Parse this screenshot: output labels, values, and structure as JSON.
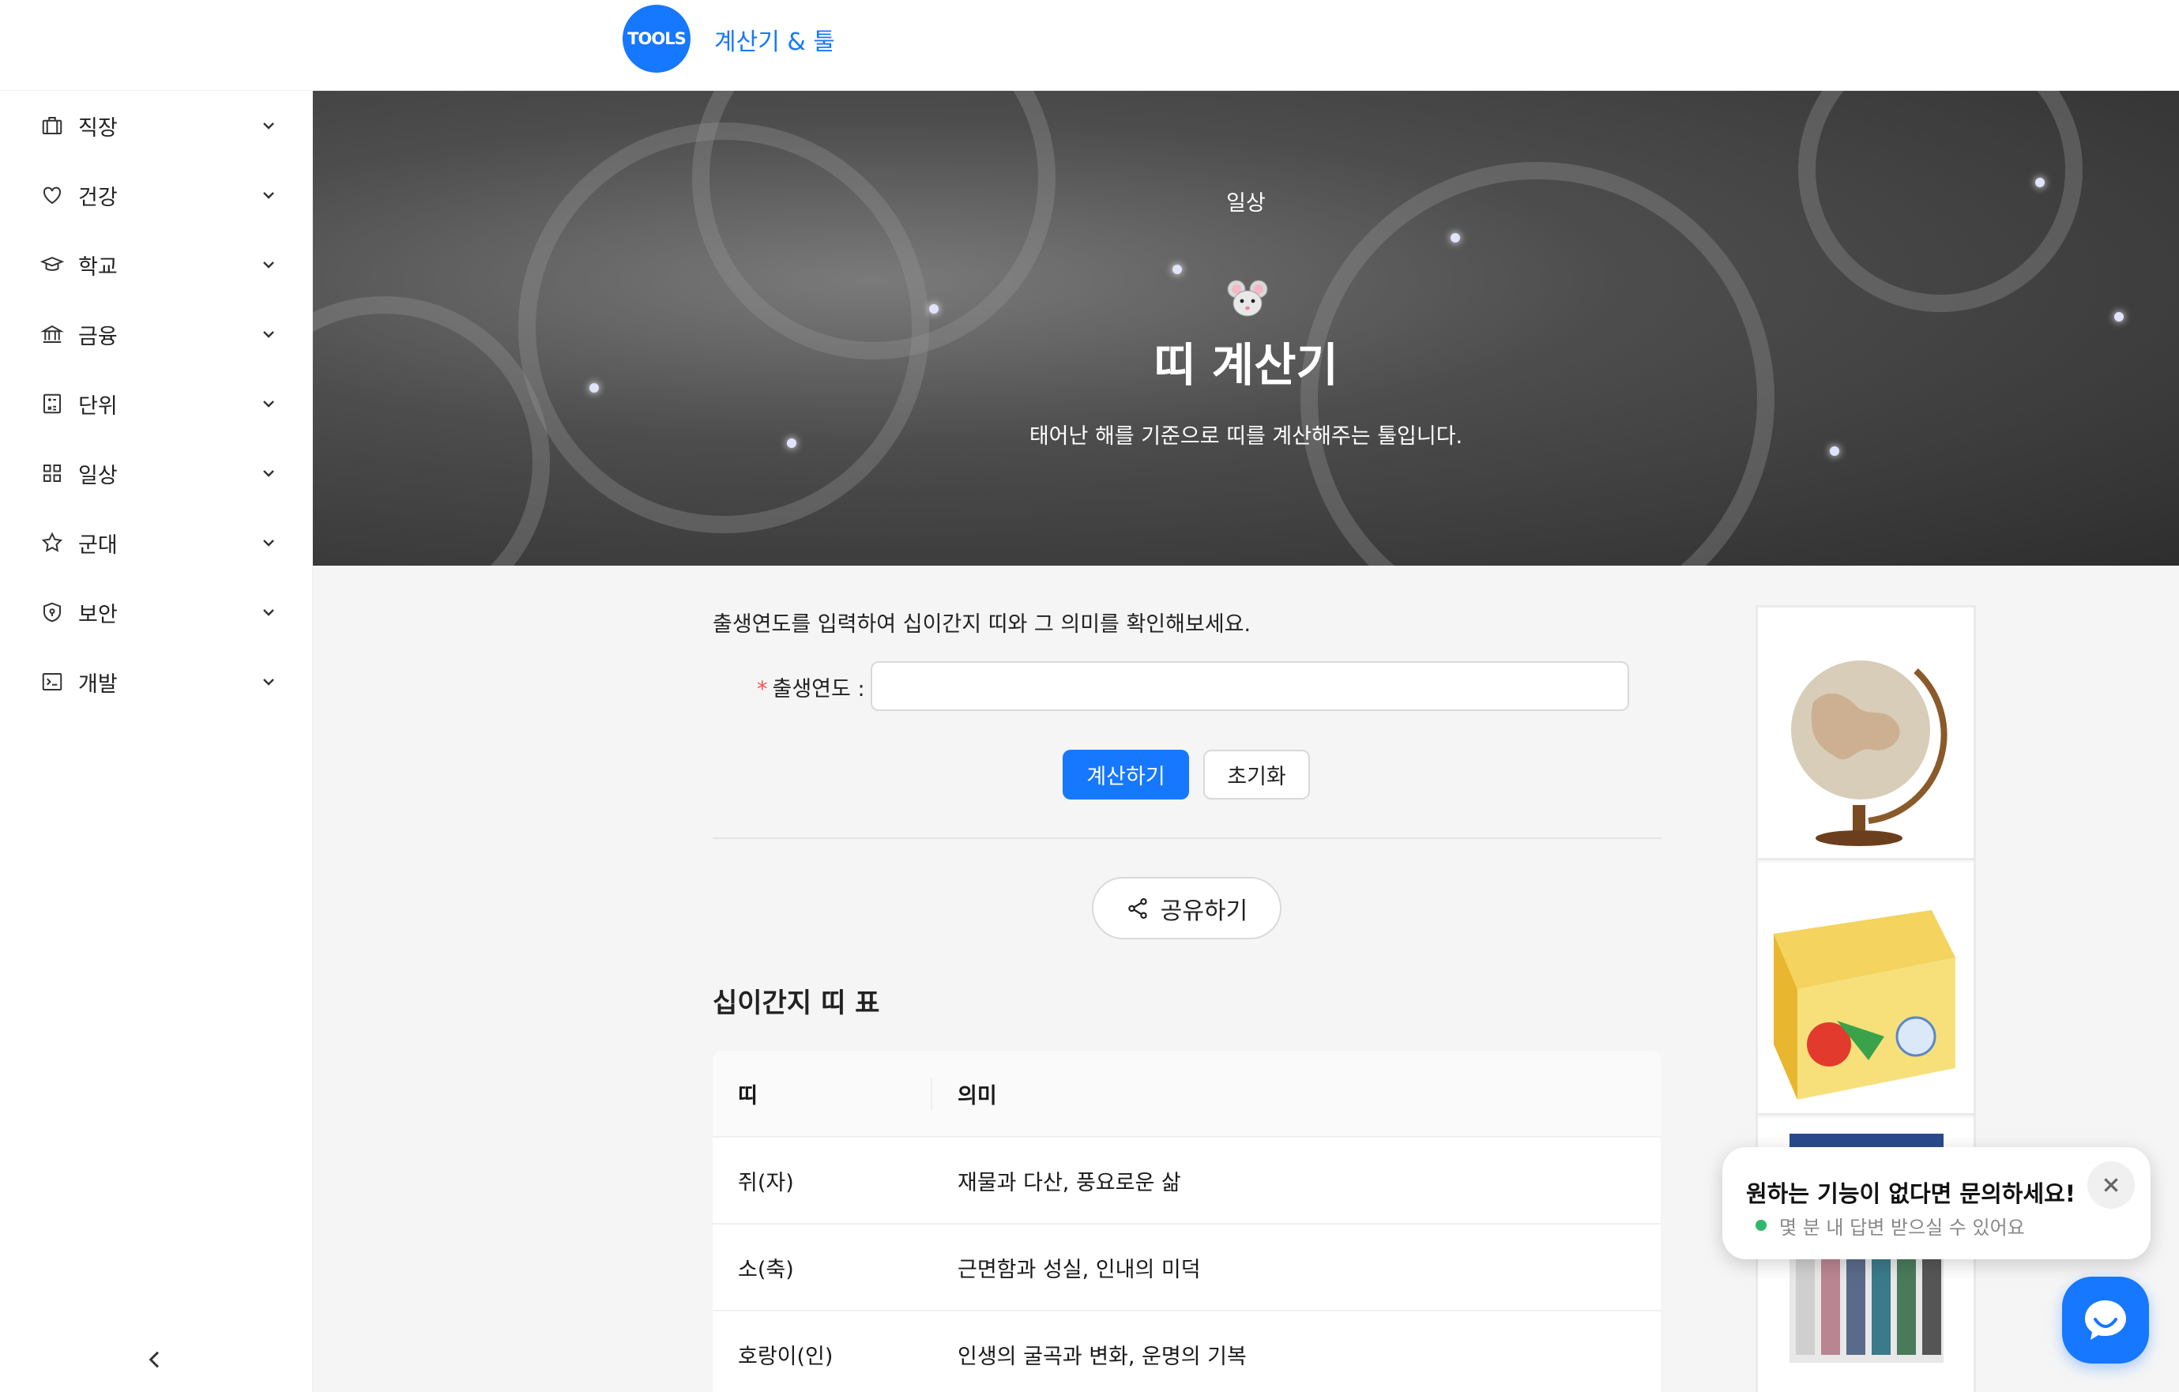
{
  "header": {
    "logo_text": "TOOLS",
    "site_title": "계산기 & 툴"
  },
  "sidebar": {
    "items": [
      {
        "label": "직장",
        "icon": "briefcase-icon"
      },
      {
        "label": "건강",
        "icon": "heart-icon"
      },
      {
        "label": "학교",
        "icon": "graduation-cap-icon"
      },
      {
        "label": "금융",
        "icon": "bank-icon"
      },
      {
        "label": "단위",
        "icon": "calculator-icon"
      },
      {
        "label": "일상",
        "icon": "grid-icon"
      },
      {
        "label": "군대",
        "icon": "star-icon"
      },
      {
        "label": "보안",
        "icon": "shield-icon"
      },
      {
        "label": "개발",
        "icon": "terminal-icon"
      }
    ]
  },
  "hero": {
    "category": "일상",
    "emoji": "mouse-face-icon",
    "title": "띠 계산기",
    "subtitle": "태어난 해를 기준으로 띠를 계산해주는 툴입니다."
  },
  "form": {
    "intro": "출생연도를 입력하여 십이간지 띠와 그 의미를 확인해보세요.",
    "required_mark": "*",
    "birth_year_label": "출생연도 :",
    "birth_year_value": "",
    "calculate_label": "계산하기",
    "reset_label": "초기화"
  },
  "share": {
    "label": "공유하기"
  },
  "table": {
    "title": "십이간지 띠 표",
    "headers": [
      "띠",
      "의미"
    ],
    "rows": [
      [
        "쥐(자)",
        "재물과 다산, 풍요로운 삶"
      ],
      [
        "소(축)",
        "근면함과 성실, 인내의 미덕"
      ],
      [
        "호랑이(인)",
        "인생의 굴곡과 변화, 운명의 기복"
      ]
    ]
  },
  "chat": {
    "title": "원하는 기능이 없다면 문의하세요!",
    "subtitle": "몇 분 내 답변 받으실 수 있어요"
  },
  "colors": {
    "accent": "#1677ff",
    "required": "#ff4d4f",
    "online": "#2fb86b"
  }
}
